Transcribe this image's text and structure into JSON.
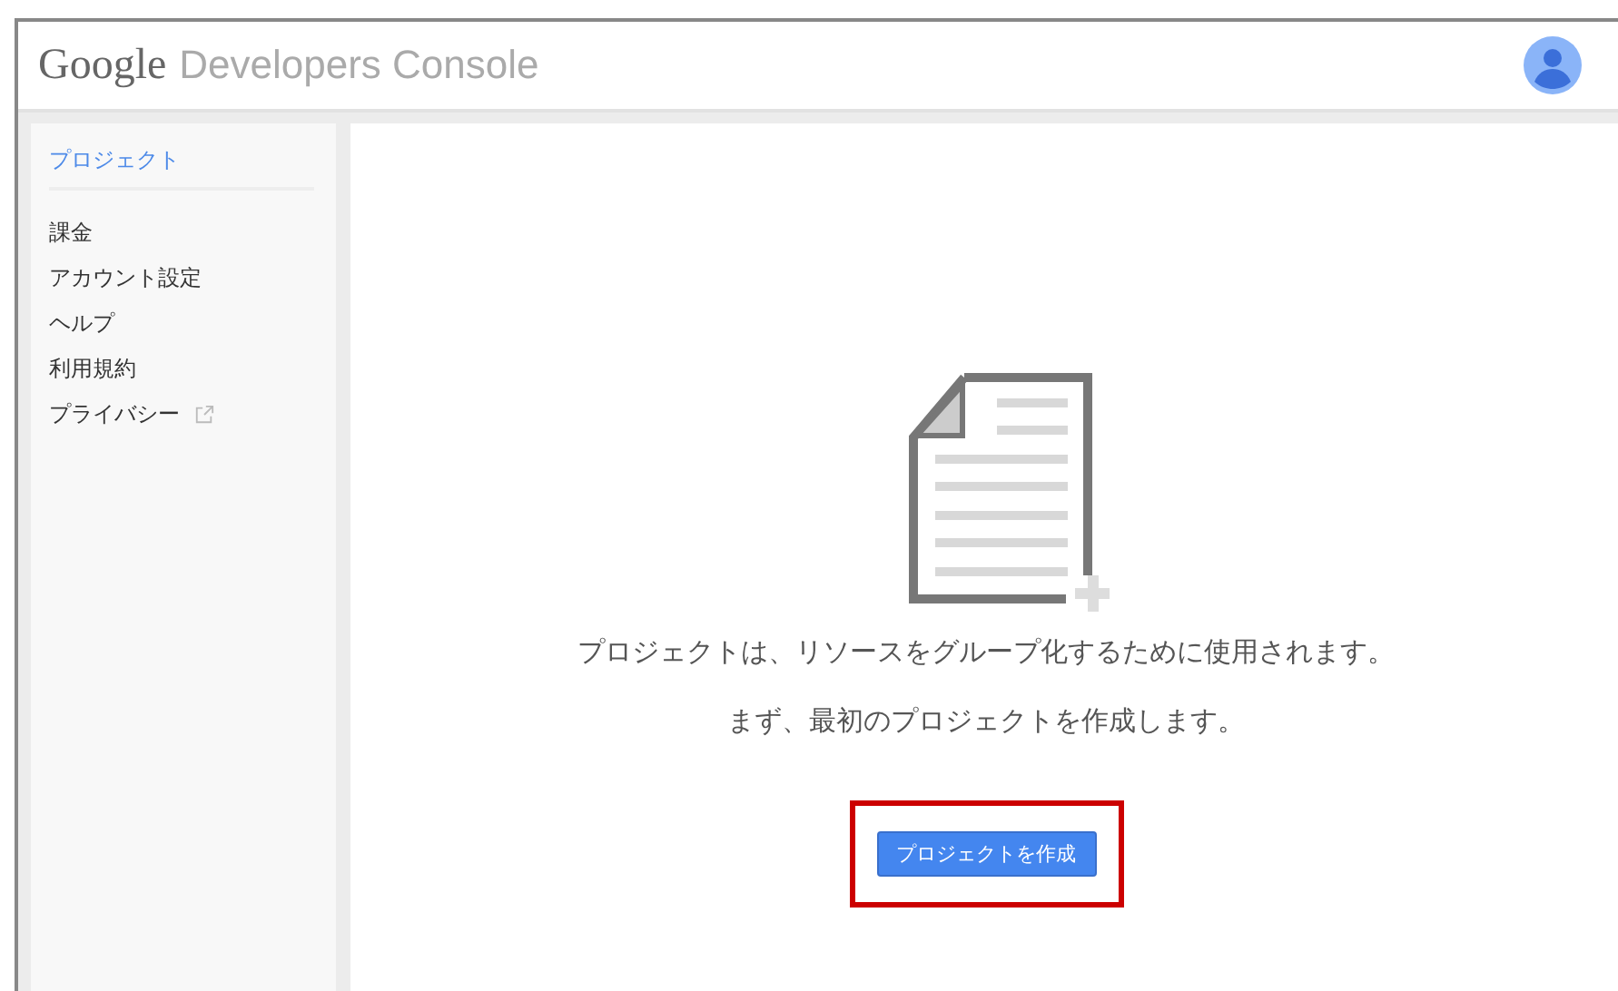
{
  "header": {
    "logo": "Google",
    "product": "Developers Console"
  },
  "sidebar": {
    "items": [
      {
        "label": "プロジェクト",
        "selected": true,
        "external": false
      },
      {
        "label": "課金",
        "selected": false,
        "external": false
      },
      {
        "label": "アカウント設定",
        "selected": false,
        "external": false
      },
      {
        "label": "ヘルプ",
        "selected": false,
        "external": false
      },
      {
        "label": "利用規約",
        "selected": false,
        "external": false
      },
      {
        "label": "プライバシー",
        "selected": false,
        "external": true
      }
    ]
  },
  "main": {
    "description": "プロジェクトは、リソースをグループ化するために使用されます。",
    "prompt": "まず、最初のプロジェクトを作成します。",
    "button": {
      "label": "プロジェクトを作成",
      "highlighted": true
    }
  }
}
